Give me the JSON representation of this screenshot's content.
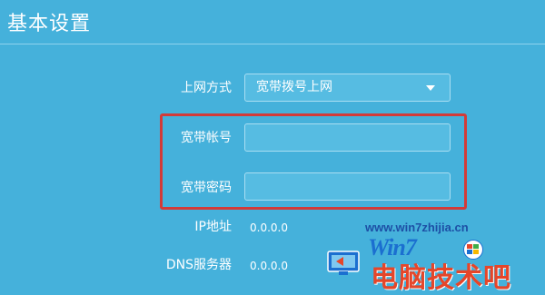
{
  "page": {
    "title": "基本设置"
  },
  "form": {
    "connection_type": {
      "label": "上网方式",
      "value": "宽带拨号上网"
    },
    "account": {
      "label": "宽带帐号",
      "value": ""
    },
    "password": {
      "label": "宽带密码",
      "value": ""
    },
    "ip": {
      "label": "IP地址",
      "value": "0.0.0.0"
    },
    "dns": {
      "label": "DNS服务器",
      "value": "0.0.0.0"
    }
  },
  "colors": {
    "background": "#45b1db",
    "highlight": "#d23b39"
  },
  "watermark": {
    "url": "www.win7zhijia.cn",
    "logo": "Win7",
    "text": "电脑技术吧"
  }
}
